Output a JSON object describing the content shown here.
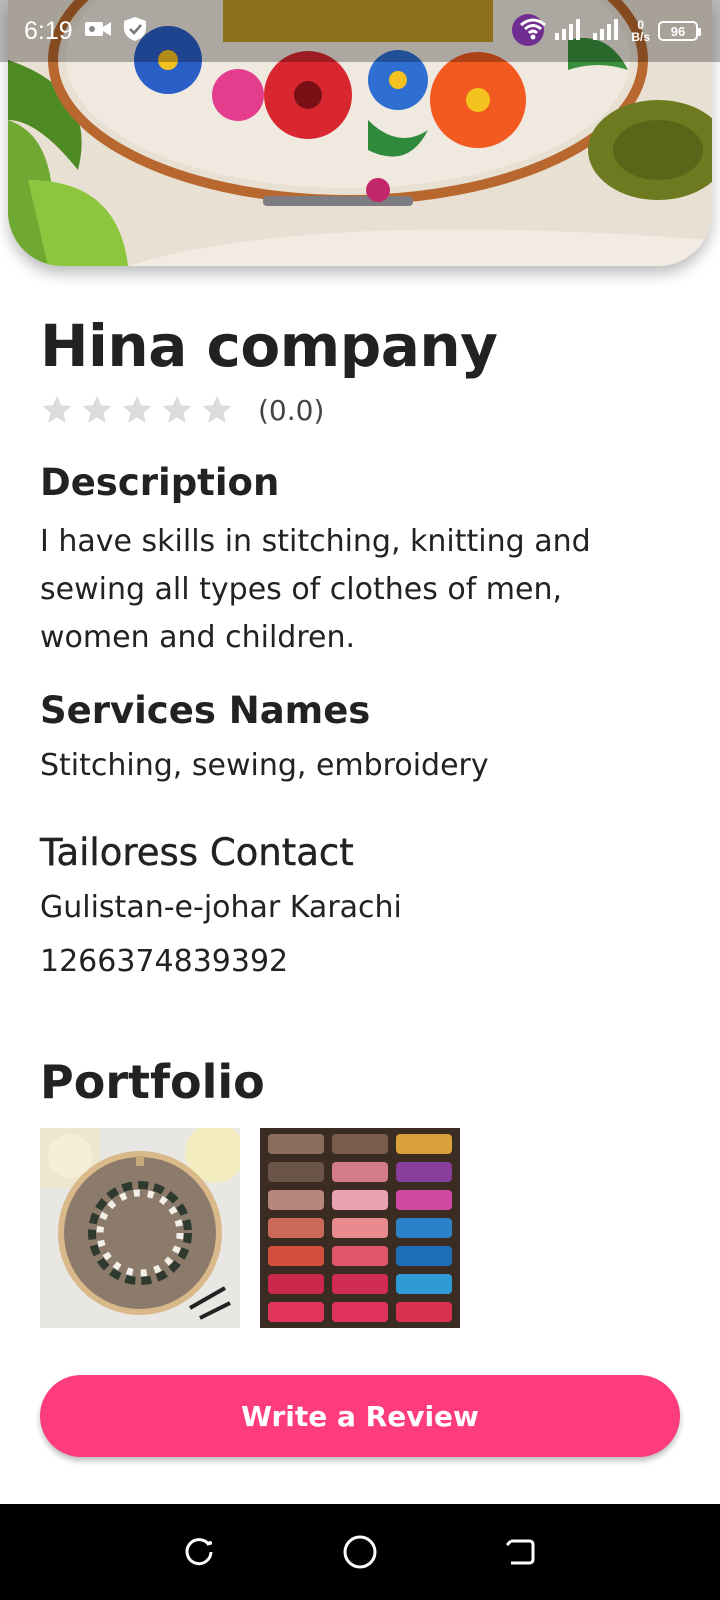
{
  "status_bar": {
    "time": "6:19",
    "speed_value": "0",
    "speed_unit": "B/s",
    "battery": "96"
  },
  "provider": {
    "name": "Hina company",
    "rating_text": "(0.0)",
    "rating_value": 0,
    "rating_max": 5
  },
  "description": {
    "heading": "Description",
    "text": "I have skills in stitching, knitting and sewing all types of clothes of men, women and children."
  },
  "services": {
    "heading": "Services Names",
    "text": "Stitching, sewing, embroidery"
  },
  "contact": {
    "heading": "Tailoress Contact",
    "address": "Gulistan-e-johar Karachi",
    "phone": "1266374839392"
  },
  "portfolio": {
    "heading": "Portfolio"
  },
  "actions": {
    "write_review": "Write a Review"
  },
  "colors": {
    "accent": "#fd3c7c",
    "star_empty": "#dcdcdc"
  }
}
